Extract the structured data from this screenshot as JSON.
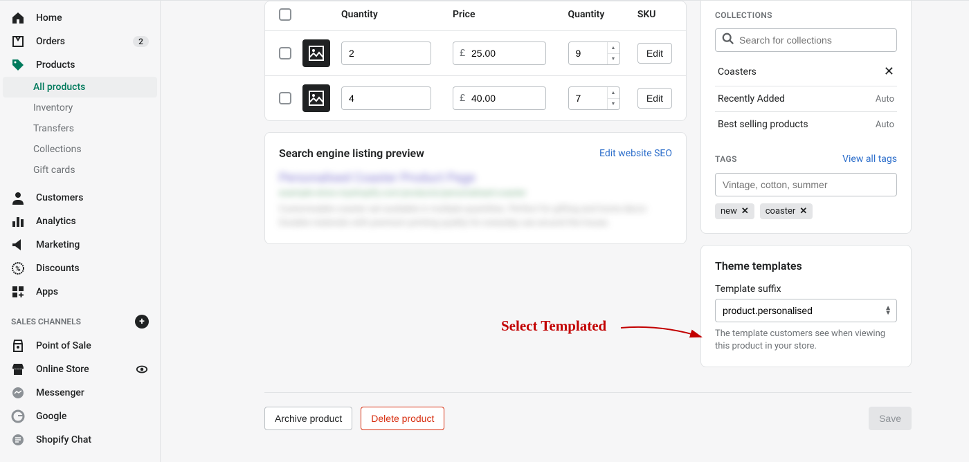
{
  "sidebar": {
    "home": "Home",
    "orders": "Orders",
    "orders_badge": "2",
    "products": "Products",
    "all_products": "All products",
    "inventory": "Inventory",
    "transfers": "Transfers",
    "collections": "Collections",
    "gift_cards": "Gift cards",
    "customers": "Customers",
    "analytics": "Analytics",
    "marketing": "Marketing",
    "discounts": "Discounts",
    "apps": "Apps",
    "sales_channels": "SALES CHANNELS",
    "pos": "Point of Sale",
    "online_store": "Online Store",
    "messenger": "Messenger",
    "google": "Google",
    "shopify_chat": "Shopify Chat"
  },
  "variants": {
    "headers": {
      "quantity1": "Quantity",
      "price": "Price",
      "quantity2": "Quantity",
      "sku": "SKU"
    },
    "currency": "£",
    "rows": [
      {
        "qty": "2",
        "price": "25.00",
        "stock": "9"
      },
      {
        "qty": "4",
        "price": "40.00",
        "stock": "7"
      }
    ],
    "edit_label": "Edit"
  },
  "seo": {
    "title": "Search engine listing preview",
    "edit_link": "Edit website SEO",
    "preview_title": "Personalised Coaster Product Page",
    "preview_url": "example-store.myshopify.com/products/personalised-coaster",
    "preview_desc": "Customisable coaster set available in multiple quantities. Perfect for gifting and home decor. Durable materials with premium printing quality for everyday use around the house."
  },
  "collections": {
    "header": "COLLECTIONS",
    "search_placeholder": "Search for collections",
    "items": [
      {
        "name": "Coasters",
        "removable": true
      },
      {
        "name": "Recently Added",
        "auto": "Auto"
      },
      {
        "name": "Best selling products",
        "auto": "Auto"
      }
    ]
  },
  "tags": {
    "header": "TAGS",
    "view_all": "View all tags",
    "placeholder": "Vintage, cotton, summer",
    "chips": [
      "new",
      "coaster"
    ]
  },
  "theme": {
    "title": "Theme templates",
    "label": "Template suffix",
    "value": "product.personalised",
    "help": "The template customers see when viewing this product in your store."
  },
  "footer": {
    "archive": "Archive product",
    "delete": "Delete product",
    "save": "Save"
  },
  "annotation": "Select Templated"
}
